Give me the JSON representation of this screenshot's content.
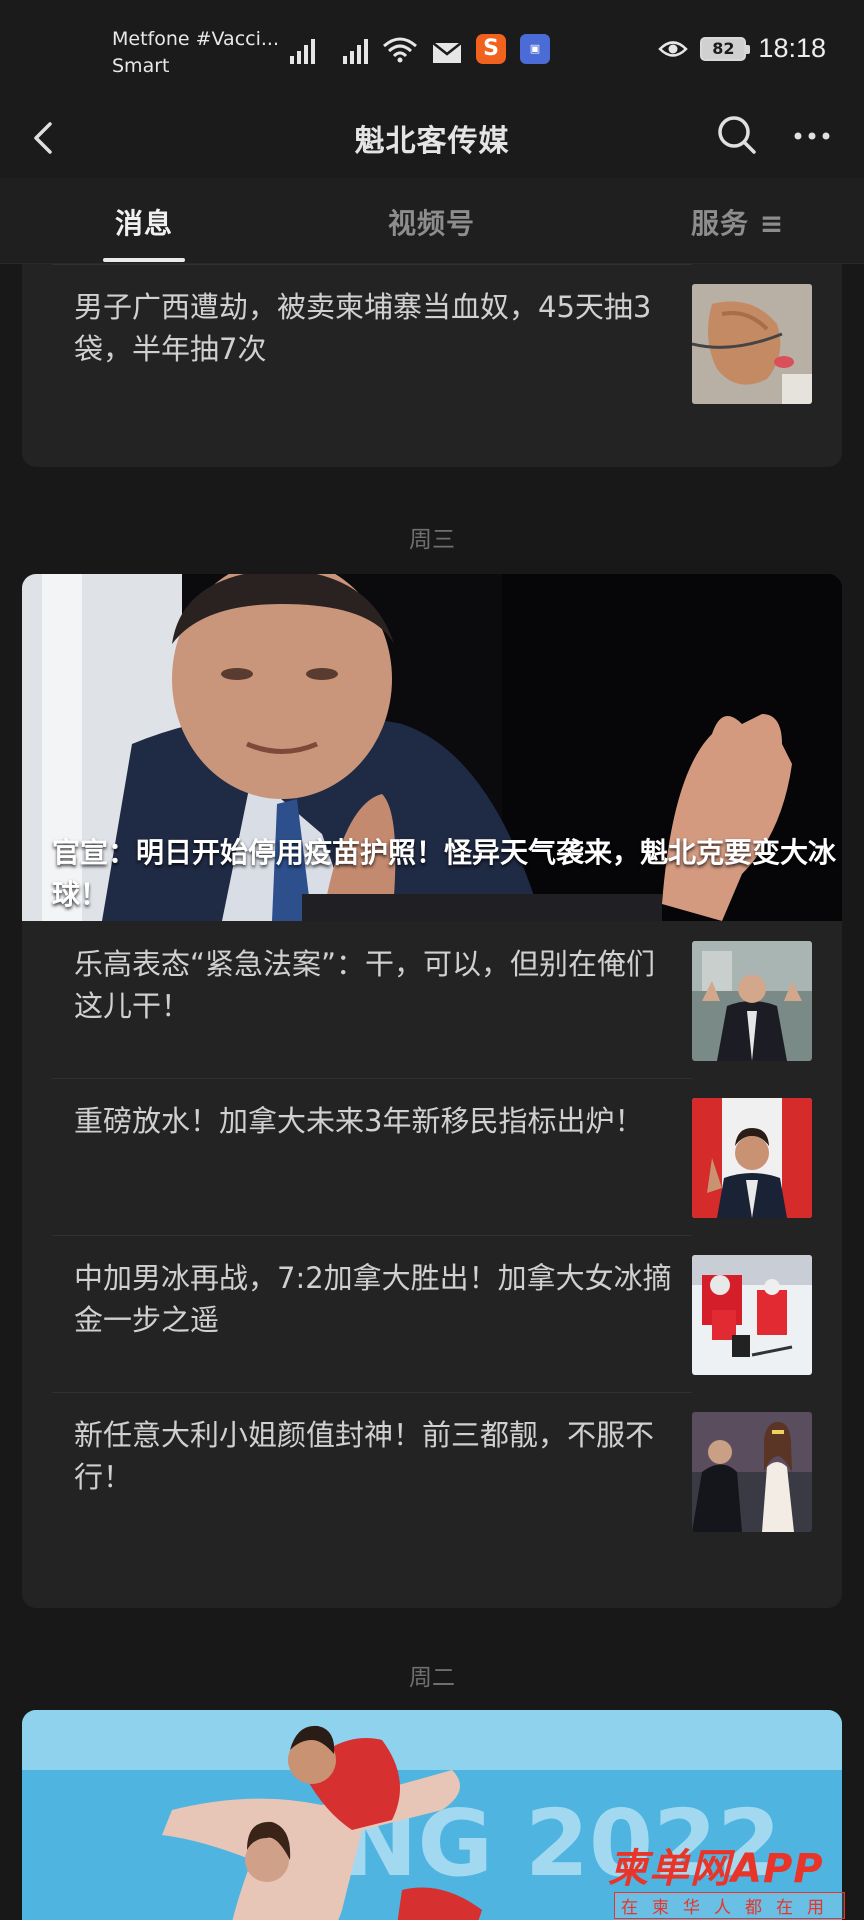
{
  "status_bar": {
    "carrier_line1": "Metfone #Vacci...",
    "carrier_line2": "Smart",
    "battery": "82",
    "time": "18:18",
    "icons": [
      "signal-r-icon",
      "signal-icon",
      "wifi-icon",
      "mail-icon",
      "sogou-icon",
      "app-icon",
      "eye-icon",
      "battery-icon"
    ]
  },
  "header": {
    "title": "魁北客传媒"
  },
  "tabs": [
    {
      "label": "消息",
      "active": true
    },
    {
      "label": "视频号",
      "active": false
    },
    {
      "label": "服务 ≡",
      "active": false
    }
  ],
  "feed": {
    "top_card": {
      "item": {
        "title": "男子广西遭劫，被卖柬埔寨当血奴，45天抽3袋，半年抽7次"
      }
    },
    "day1": "周三",
    "card1": {
      "hero_title": "官宣：明日开始停用疫苗护照！怪异天气袭来，魁北克要变大冰球！",
      "items": [
        {
          "title": "乐高表态“紧急法案”：干，可以，但别在俺们这儿干！"
        },
        {
          "title": "重磅放水！加拿大未来3年新移民指标出炉！"
        },
        {
          "title": "中加男冰再战，7:2加拿大胜出！加拿大女冰摘金一步之遥"
        },
        {
          "title": "新任意大利小姐颜值封神！前三都靓，不服不行！"
        }
      ]
    },
    "day2": "周二"
  },
  "watermark": {
    "main": "柬单网APP",
    "sub": "在柬华人都在用"
  },
  "colors": {
    "background": "#181818",
    "card": "#232323",
    "text": "#d0d0d0",
    "muted": "#6f6f6f",
    "watermark": "#e9342a"
  }
}
